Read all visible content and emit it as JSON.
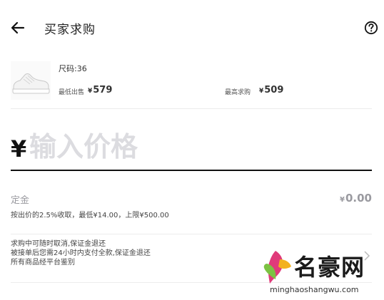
{
  "header": {
    "title": "买家求购",
    "back_icon": "arrow-left-icon",
    "help_icon": "question-circle-icon"
  },
  "product": {
    "size_text": "尺码:36",
    "lowest_sell_label": "最低出售",
    "lowest_sell_currency": "¥",
    "lowest_sell_value": "579",
    "highest_buy_label": "最高求购",
    "highest_buy_currency": "¥",
    "highest_buy_value": "509"
  },
  "price_input": {
    "currency": "¥",
    "placeholder": "输入价格",
    "value": ""
  },
  "deposit": {
    "label": "定金",
    "currency": "¥",
    "value": "0.00",
    "note": "按出价的2.5%收取，最低¥14.00，上限¥500.00"
  },
  "rules": {
    "lines": [
      "求购中可随时取消,保证金退还",
      "被接单后您需24小时内支付全款,保证金退还",
      "所有商品经平台鉴别"
    ]
  },
  "watermark": {
    "text": "名豪网",
    "url": "minghaoshangwu.com"
  },
  "colors": {
    "accent": "#111111",
    "muted": "#9a9aa0",
    "placeholder": "#dcdce0"
  }
}
